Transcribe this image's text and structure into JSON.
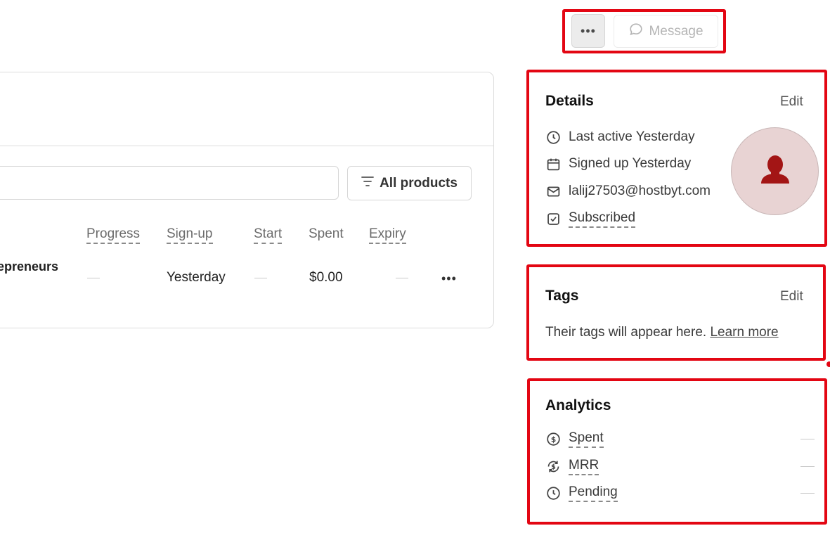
{
  "toolbar": {
    "more_label": "···",
    "message_label": "Message"
  },
  "filter": {
    "label": "All products"
  },
  "table": {
    "headers": [
      "Progress",
      "Sign-up",
      "Start",
      "Spent",
      "Expiry"
    ],
    "row": {
      "name": "epreneurs",
      "progress": "—",
      "signup": "Yesterday",
      "start": "—",
      "spent": "$0.00",
      "expiry": "—",
      "more": "···"
    }
  },
  "details": {
    "title": "Details",
    "edit": "Edit",
    "last_active": "Last active Yesterday",
    "signed_up": "Signed up Yesterday",
    "email": "lalij27503@hostbyt.com",
    "subscribed": "Subscribed"
  },
  "tags": {
    "title": "Tags",
    "edit": "Edit",
    "empty_text": "Their tags will appear here.",
    "learn_more": "Learn more"
  },
  "analytics": {
    "title": "Analytics",
    "items": [
      {
        "label": "Spent",
        "value": "—"
      },
      {
        "label": "MRR",
        "value": "—"
      },
      {
        "label": "Pending",
        "value": "—"
      }
    ]
  },
  "colors": {
    "highlight": "#e30613",
    "avatar_bg": "#e8d3d3",
    "avatar_icon": "#a31515"
  }
}
